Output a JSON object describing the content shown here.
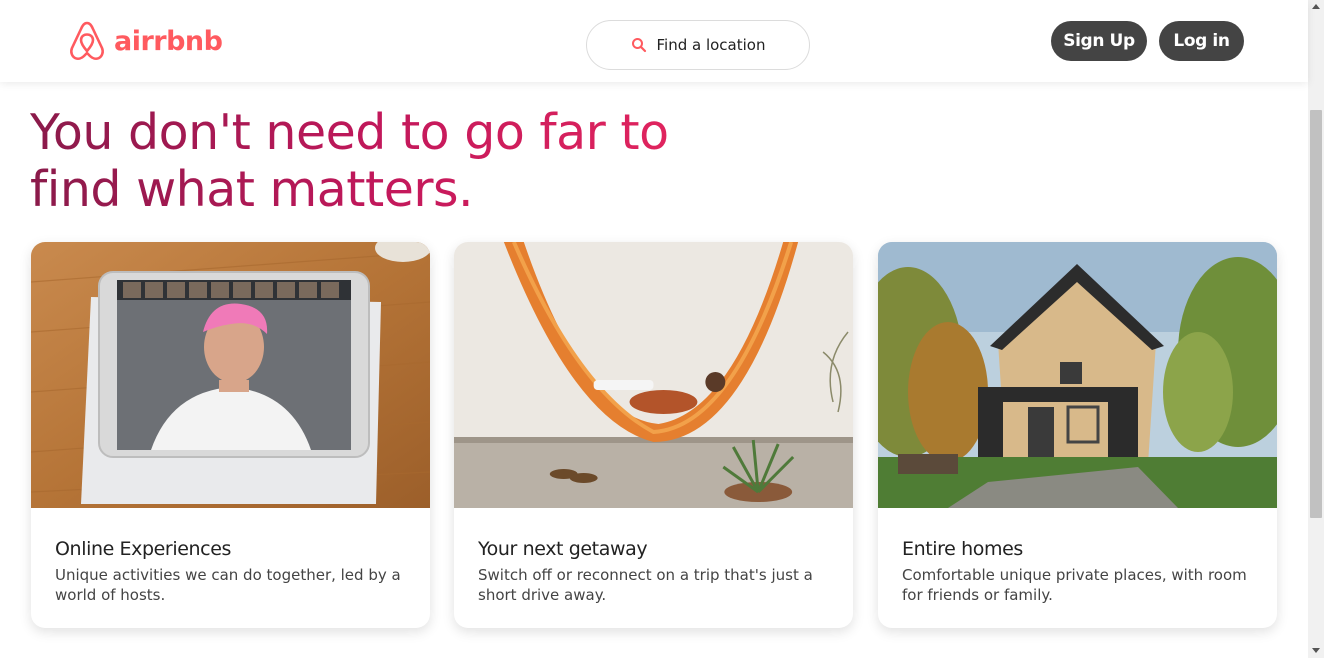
{
  "header": {
    "brand": "airrbnb",
    "search_label": "Find a location",
    "signup_label": "Sign Up",
    "login_label": "Log in"
  },
  "hero": {
    "headline_line1": "You don't need to go far to",
    "headline_line2": "find what matters."
  },
  "cards": [
    {
      "title": "Online Experiences",
      "description": "Unique activities we can do together, led by a world of hosts.",
      "image": "tablet-video-call-photo"
    },
    {
      "title": "Your next getaway",
      "description": "Switch off or reconnect on a trip that's just a short drive away.",
      "image": "hammock-photo"
    },
    {
      "title": "Entire homes",
      "description": "Comfortable unique private places, with room for friends or family.",
      "image": "cabin-house-photo"
    }
  ],
  "colors": {
    "brand": "#ff5a5f",
    "headline_start": "#8a1a4a",
    "headline_end": "#e0245e",
    "button_bg": "#444444"
  }
}
